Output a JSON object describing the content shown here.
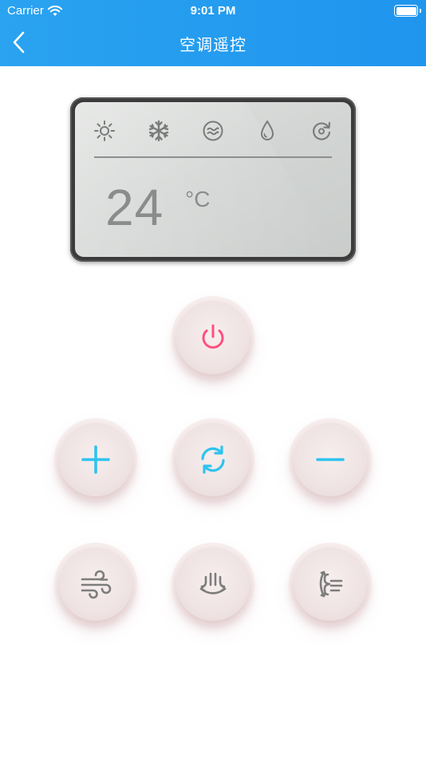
{
  "status_bar": {
    "carrier": "Carrier",
    "time": "9:01 PM"
  },
  "nav": {
    "title": "空调遥控",
    "back_icon": "chevron-left-icon"
  },
  "display": {
    "modes": [
      "sun-icon",
      "snowflake-icon",
      "dehumidify-icon",
      "drop-icon",
      "auto-cycle-icon"
    ],
    "temperature": "24",
    "unit": "°C"
  },
  "buttons": {
    "power": "power-icon",
    "row1": [
      "plus-icon",
      "mode-cycle-icon",
      "minus-icon"
    ],
    "row2": [
      "wind-speed-icon",
      "vertical-swing-icon",
      "horizontal-swing-icon"
    ]
  },
  "colors": {
    "header": "#2aa3f0",
    "power": "#ff4f7e",
    "accent": "#2ec3ee",
    "icon_gray": "#7d7d7d"
  }
}
